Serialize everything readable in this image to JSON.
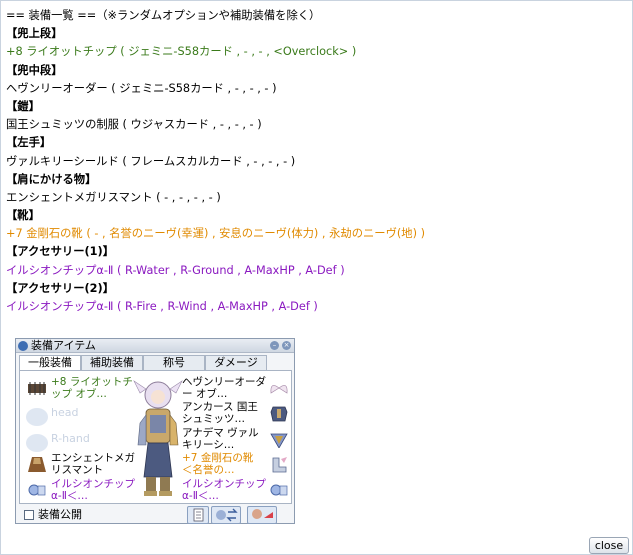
{
  "log": {
    "lines": [
      {
        "text": "  == 装備一覧 ==（※ランダムオプションや補助装備を除く）",
        "color": "black",
        "bold": false
      },
      {
        "text": "【兜上段】",
        "color": "black",
        "bold": true
      },
      {
        "text": "+8 ライオットチップ ( ジェミニ-S58カード , - , - , <Overclock> )",
        "color": "green",
        "bold": false
      },
      {
        "text": "【兜中段】",
        "color": "black",
        "bold": true
      },
      {
        "text": "ヘヴンリーオーダー ( ジェミニ-S58カード , - , - , - )",
        "color": "black",
        "bold": false
      },
      {
        "text": "【鎧】",
        "color": "black",
        "bold": true
      },
      {
        "text": "国王シュミッツの制服 ( ウジャスカード , - , - , - )",
        "color": "black",
        "bold": false
      },
      {
        "text": "【左手】",
        "color": "black",
        "bold": true
      },
      {
        "text": "ヴァルキリーシールド ( フレームスカルカード , - , - , - )",
        "color": "black",
        "bold": false
      },
      {
        "text": "【肩にかける物】",
        "color": "black",
        "bold": true
      },
      {
        "text": "エンシェントメガリスマント ( - , - , - , - )",
        "color": "black",
        "bold": false
      },
      {
        "text": "【靴】",
        "color": "black",
        "bold": true
      },
      {
        "text": "+7 金剛石の靴 ( - , 名誉のニーヴ(幸運) , 安息のニーヴ(体力) , 永劫のニーヴ(地) )",
        "color": "orange",
        "bold": false
      },
      {
        "text": "【アクセサリー(1)】",
        "color": "black",
        "bold": true
      },
      {
        "text": "イルシオンチップα-Ⅱ ( R-Water , R-Ground , A-MaxHP , A-Def )",
        "color": "purple",
        "bold": false
      },
      {
        "text": "【アクセサリー(2)】",
        "color": "black",
        "bold": true
      },
      {
        "text": "イルシオンチップα-Ⅱ ( R-Fire , R-Wind , A-MaxHP , A-Def )",
        "color": "purple",
        "bold": false
      }
    ]
  },
  "colors": {
    "black": "#000000",
    "green": "#3a7a1a",
    "orange": "#e08a00",
    "purple": "#8a19c0"
  },
  "equip_window": {
    "title": "装備アイテム",
    "tabs": [
      "一般装備",
      "補助装備",
      "称号",
      "ダメージ"
    ],
    "left_slots": [
      {
        "text": "+8 ライオットチップ オブ…",
        "color": "green",
        "icon": "chip-icon",
        "ghost": false
      },
      {
        "text": "head",
        "color": "ghost",
        "icon": "empty-slot-icon",
        "ghost": true
      },
      {
        "text": "R-hand",
        "color": "ghost",
        "icon": "empty-slot-icon",
        "ghost": true
      },
      {
        "text": "エンシェントメガリスマント",
        "color": "black",
        "icon": "cape-icon",
        "ghost": false
      },
      {
        "text": "イルシオンチップα-Ⅱ＜…",
        "color": "purple",
        "icon": "accessory-icon",
        "ghost": false
      }
    ],
    "right_slots": [
      {
        "text": "ヘヴンリーオーダー オブ…",
        "color": "black",
        "icon": "wings-icon"
      },
      {
        "text": "アンカース 国王シュミッツ…",
        "color": "black",
        "icon": "armor-icon"
      },
      {
        "text": "アナデマ ヴァルキリーシ…",
        "color": "black",
        "icon": "shield-icon"
      },
      {
        "text": "+7 金剛石の靴 ＜名誉の…",
        "color": "orange",
        "icon": "boots-icon"
      },
      {
        "text": "イルシオンチップα-Ⅱ＜…",
        "color": "purple",
        "icon": "accessory-icon"
      }
    ],
    "public_label": "装備公開",
    "close_label": "close"
  }
}
